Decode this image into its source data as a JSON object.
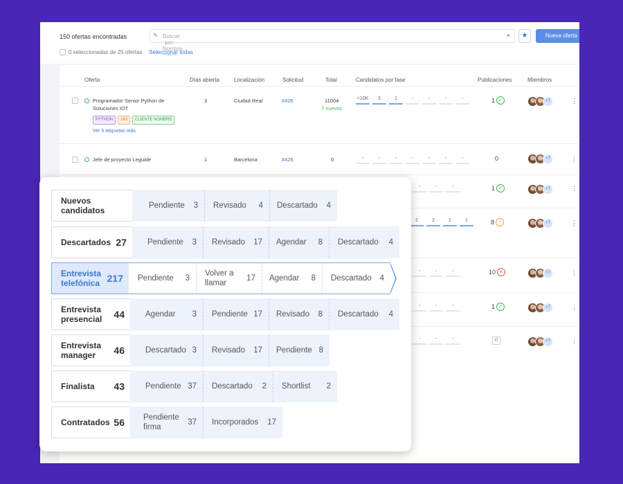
{
  "toolbar": {
    "count": "150 ofertas encontradas",
    "search_placeholder": "Buscar por: Nombre...",
    "new_button": "Nueva oferta",
    "selected": "0 seleccionadas de 25 ofertas",
    "select_all": "Seleccionar todas"
  },
  "table": {
    "headers": [
      "Oferta",
      "Días abierta",
      "Localización",
      "Solicitud",
      "Total",
      "Candidatos por fase",
      "Publicaciones",
      "Miembros"
    ],
    "rows": [
      {
        "title_line1": "Programador Senior Python de",
        "title_line2": "Soluciones IOT",
        "tags": [
          "PYTHON",
          "243",
          "CLIENTE NOMBRE"
        ],
        "more": "Ver 5 etiquetas más",
        "days": "3",
        "location": "Ciudad Real",
        "request": "#426",
        "total": "11004",
        "total_sub": "7 nuevos",
        "phases": [
          "+10K",
          "3",
          "1",
          "-",
          "-",
          "-",
          "-",
          "-"
        ],
        "pub": "1",
        "members_more": "+7"
      },
      {
        "title_line1": "Jefe de proyecto Leguide",
        "days": "1",
        "location": "Barcelona",
        "request": "#426",
        "total": "0",
        "phases": [
          "-",
          "-",
          "-",
          "-",
          "-",
          "-"
        ],
        "pub": "0",
        "members_more": "+7"
      }
    ],
    "pubs_hidden_rows": [
      "1",
      "8",
      "10",
      "1",
      "0"
    ],
    "phases_row4": [
      "2",
      "2",
      "1",
      "1"
    ],
    "members_more": "+7"
  },
  "pipeline": [
    {
      "stage": "Nuevos candidatos",
      "count": "",
      "subs": [
        [
          "Pendiente",
          "3"
        ],
        [
          "Revisado",
          "4"
        ],
        [
          "Descartado",
          "4"
        ]
      ]
    },
    {
      "stage": "Descartados",
      "count": "27",
      "subs": [
        [
          "Pendiente",
          "3"
        ],
        [
          "Revisado",
          "17"
        ],
        [
          "Agendar",
          "8"
        ],
        [
          "Descartado",
          "4"
        ]
      ]
    },
    {
      "stage": "Entrevista telefónica",
      "count": "217",
      "subs": [
        [
          "Pendiente",
          "3"
        ],
        [
          "Volver a llamar",
          "17"
        ],
        [
          "Agendar",
          "8"
        ],
        [
          "Descartado",
          "4"
        ]
      ]
    },
    {
      "stage": "Entrevista presencial",
      "count": "44",
      "subs": [
        [
          "Agendar",
          "3"
        ],
        [
          "Pendiente",
          "17"
        ],
        [
          "Revisado",
          "8"
        ],
        [
          "Descartado",
          "4"
        ]
      ]
    },
    {
      "stage": "Entrevista manager",
      "count": "46",
      "subs": [
        [
          "Descartado",
          "3"
        ],
        [
          "Revisado",
          "17"
        ],
        [
          "Pendiente",
          "8"
        ]
      ]
    },
    {
      "stage": "Finalista",
      "count": "43",
      "subs": [
        [
          "Pendiente",
          "37"
        ],
        [
          "Descartado",
          "2"
        ],
        [
          "Shortlist",
          "2"
        ]
      ]
    },
    {
      "stage": "Contratados",
      "count": "56",
      "subs": [
        [
          "Pendiente firma",
          "37"
        ],
        [
          "Incorporados",
          "17"
        ]
      ]
    }
  ],
  "colors": {
    "background": "#4a26b5",
    "accent": "#3a78d6",
    "success": "#46b35a",
    "warning": "#f0a24a",
    "danger": "#e55353"
  }
}
